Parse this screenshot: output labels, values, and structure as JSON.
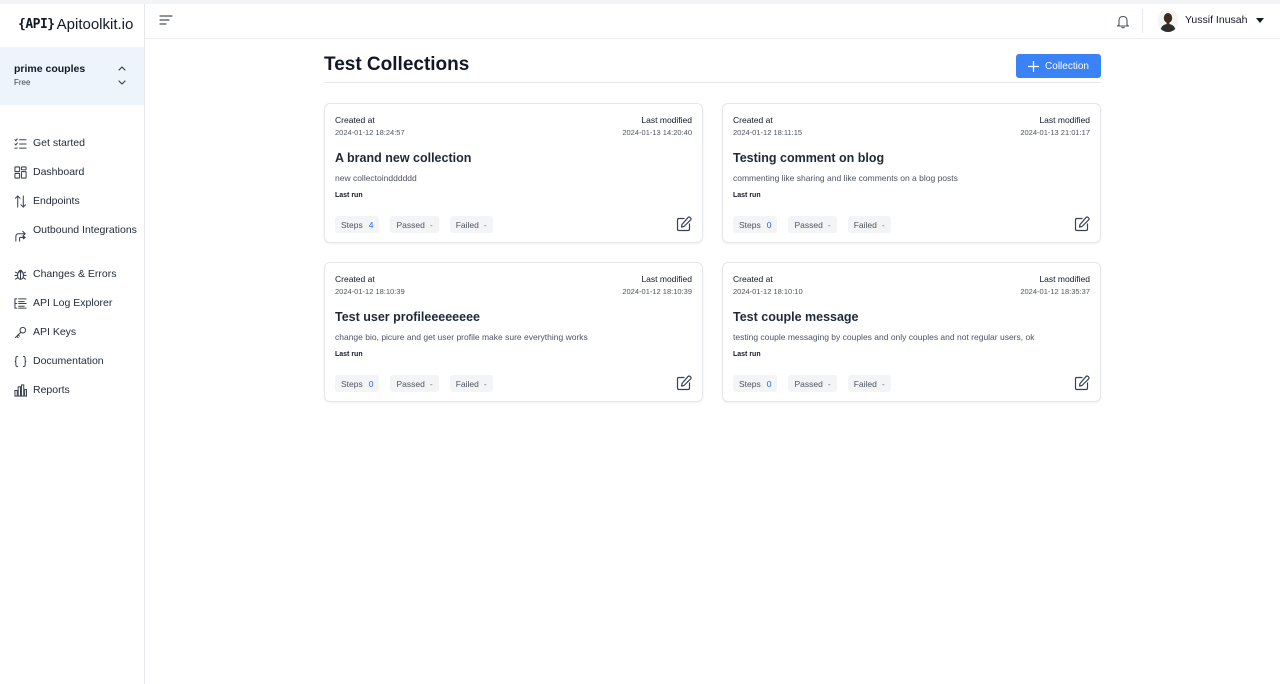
{
  "app": {
    "logo_brace": "{API}",
    "logo_name": "Apitoolkit.io"
  },
  "project": {
    "name": "prime couples",
    "plan": "Free"
  },
  "sidebar": {
    "items": [
      {
        "label": "Get started",
        "icon": "list-check-icon"
      },
      {
        "label": "Dashboard",
        "icon": "grid-icon"
      },
      {
        "label": "Endpoints",
        "icon": "arrows-swap-icon"
      },
      {
        "label": "Outbound Integrations",
        "icon": "share-arrows-icon"
      },
      {
        "label": "Changes & Errors",
        "icon": "bug-icon"
      },
      {
        "label": "API Log Explorer",
        "icon": "list-tree-icon"
      },
      {
        "label": "API Keys",
        "icon": "key-icon"
      },
      {
        "label": "Documentation",
        "icon": "braces-icon"
      },
      {
        "label": "Reports",
        "icon": "bar-chart-icon"
      }
    ]
  },
  "user": {
    "name": "Yussif Inusah"
  },
  "main": {
    "title": "Test Collections",
    "new_button_label": "Collection",
    "created_label": "Created at",
    "modified_label": "Last modified",
    "last_run_label": "Last run",
    "steps_label": "Steps",
    "passed_label": "Passed",
    "failed_label": "Failed",
    "empty_value": "-"
  },
  "collections": [
    {
      "title": "A brand new collection",
      "description": "new collectoindddddd",
      "created": "2024-01-12 18:24:57",
      "modified": "2024-01-13 14:20:40",
      "steps": "4"
    },
    {
      "title": "Testing comment on blog",
      "description": "commenting like sharing and like comments on a blog posts",
      "created": "2024-01-12 18:11:15",
      "modified": "2024-01-13 21:01:17",
      "steps": "0"
    },
    {
      "title": "Test user profileeeeeeee",
      "description": "change bio, picure and get user profile make sure everything works",
      "created": "2024-01-12 18:10:39",
      "modified": "2024-01-12 18:10:39",
      "steps": "0"
    },
    {
      "title": "Test couple message",
      "description": "testing couple messaging by couples and only couples and not regular users, ok",
      "created": "2024-01-12 18:10:10",
      "modified": "2024-01-12 18:35:37",
      "steps": "0"
    }
  ]
}
